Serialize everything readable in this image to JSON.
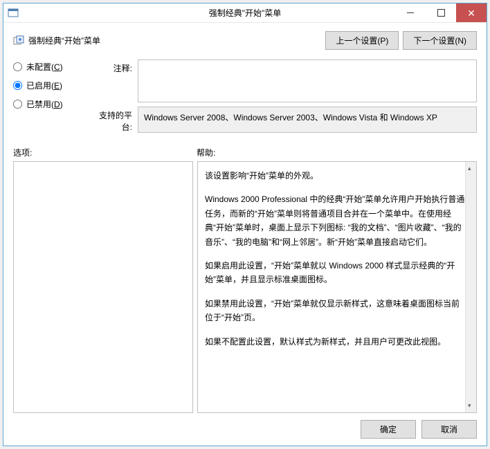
{
  "window": {
    "title": "强制经典\"开始\"菜单"
  },
  "header": {
    "policy_name": "强制经典“开始”菜单",
    "prev_btn": "上一个设置(P)",
    "next_btn": "下一个设置(N)"
  },
  "radios": {
    "not_configured": "未配置(",
    "not_configured_k": "C",
    "not_configured_end": ")",
    "enabled": "已启用(",
    "enabled_k": "E",
    "enabled_end": ")",
    "disabled": "已禁用(",
    "disabled_k": "D",
    "disabled_end": ")",
    "selected": "enabled"
  },
  "fields": {
    "comment_label": "注释:",
    "comment_value": "",
    "platform_label": "支持的平台:",
    "platform_value": "Windows Server 2008、Windows Server 2003、Windows Vista 和 Windows XP"
  },
  "panes": {
    "options_label": "选项:",
    "help_label": "帮助:"
  },
  "help_text": {
    "p1": "该设置影响“开始”菜单的外观。",
    "p2": "Windows 2000 Professional 中的经典“开始”菜单允许用户开始执行普通任务，而新的“开始”菜单则将普通项目合并在一个菜单中。在使用经典“开始”菜单时，桌面上显示下列图标: “我的文档”、“图片收藏”、“我的音乐”、“我的电脑”和“网上邻居”。新“开始”菜单直接启动它们。",
    "p3": "如果启用此设置，“开始”菜单就以 Windows 2000 样式显示经典的“开始”菜单，并且显示标准桌面图标。",
    "p4": "如果禁用此设置，“开始”菜单就仅显示新样式，这意味着桌面图标当前位于“开始”页。",
    "p5": "如果不配置此设置，默认样式为新样式，并且用户可更改此视图。"
  },
  "footer": {
    "ok": "确定",
    "cancel": "取消"
  }
}
